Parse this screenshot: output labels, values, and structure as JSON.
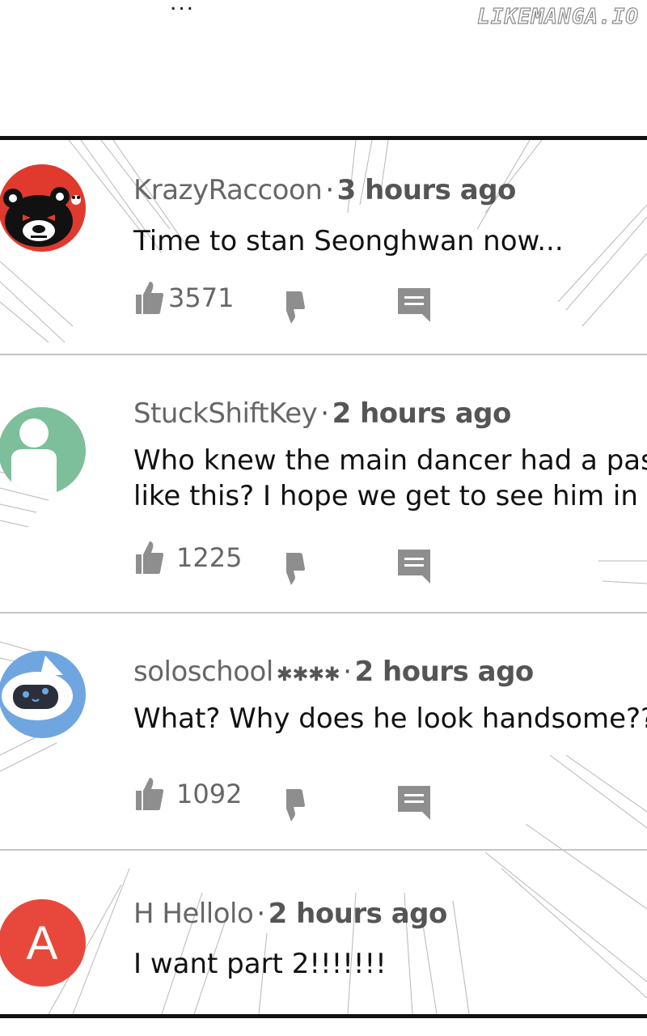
{
  "watermark": "LIKEMANGA.IO",
  "top_cut_text": "...",
  "comments": [
    {
      "username": "KrazyRaccoon",
      "separator": "·",
      "time": "3 hours ago",
      "stars": "",
      "text_lines": [
        "Time to stan Seonghwan now..."
      ],
      "likes": "3571",
      "avatar": {
        "type": "raccoon-icon",
        "bg": "#e03a2e"
      }
    },
    {
      "username": "StuckShiftKey",
      "separator": "·",
      "time": "2 hours ago",
      "stars": "",
      "text_lines": [
        "Who knew the main dancer had a past",
        "like this? I hope we get to see him in"
      ],
      "likes": "1225",
      "avatar": {
        "type": "default-user-icon",
        "bg": "#7dbf9a"
      }
    },
    {
      "username": "soloschool",
      "separator": "·",
      "time": "2 hours ago",
      "stars": "✱✱✱✱",
      "text_lines": [
        "What? Why does he look handsome??"
      ],
      "likes": "1092",
      "avatar": {
        "type": "cat-robot-icon",
        "bg": "#6fa6e0"
      }
    },
    {
      "username": "H Hellolo",
      "separator": "·",
      "time": "2 hours ago",
      "stars": "",
      "text_lines": [
        "I want part 2!!!!!!!"
      ],
      "likes": "",
      "avatar": {
        "type": "letter-avatar",
        "bg": "#e8483c",
        "letter": "A"
      }
    }
  ],
  "colors": {
    "icon_gray": "#8e8e8e",
    "divider": "#c4c4c4",
    "panel_border": "#111111"
  }
}
